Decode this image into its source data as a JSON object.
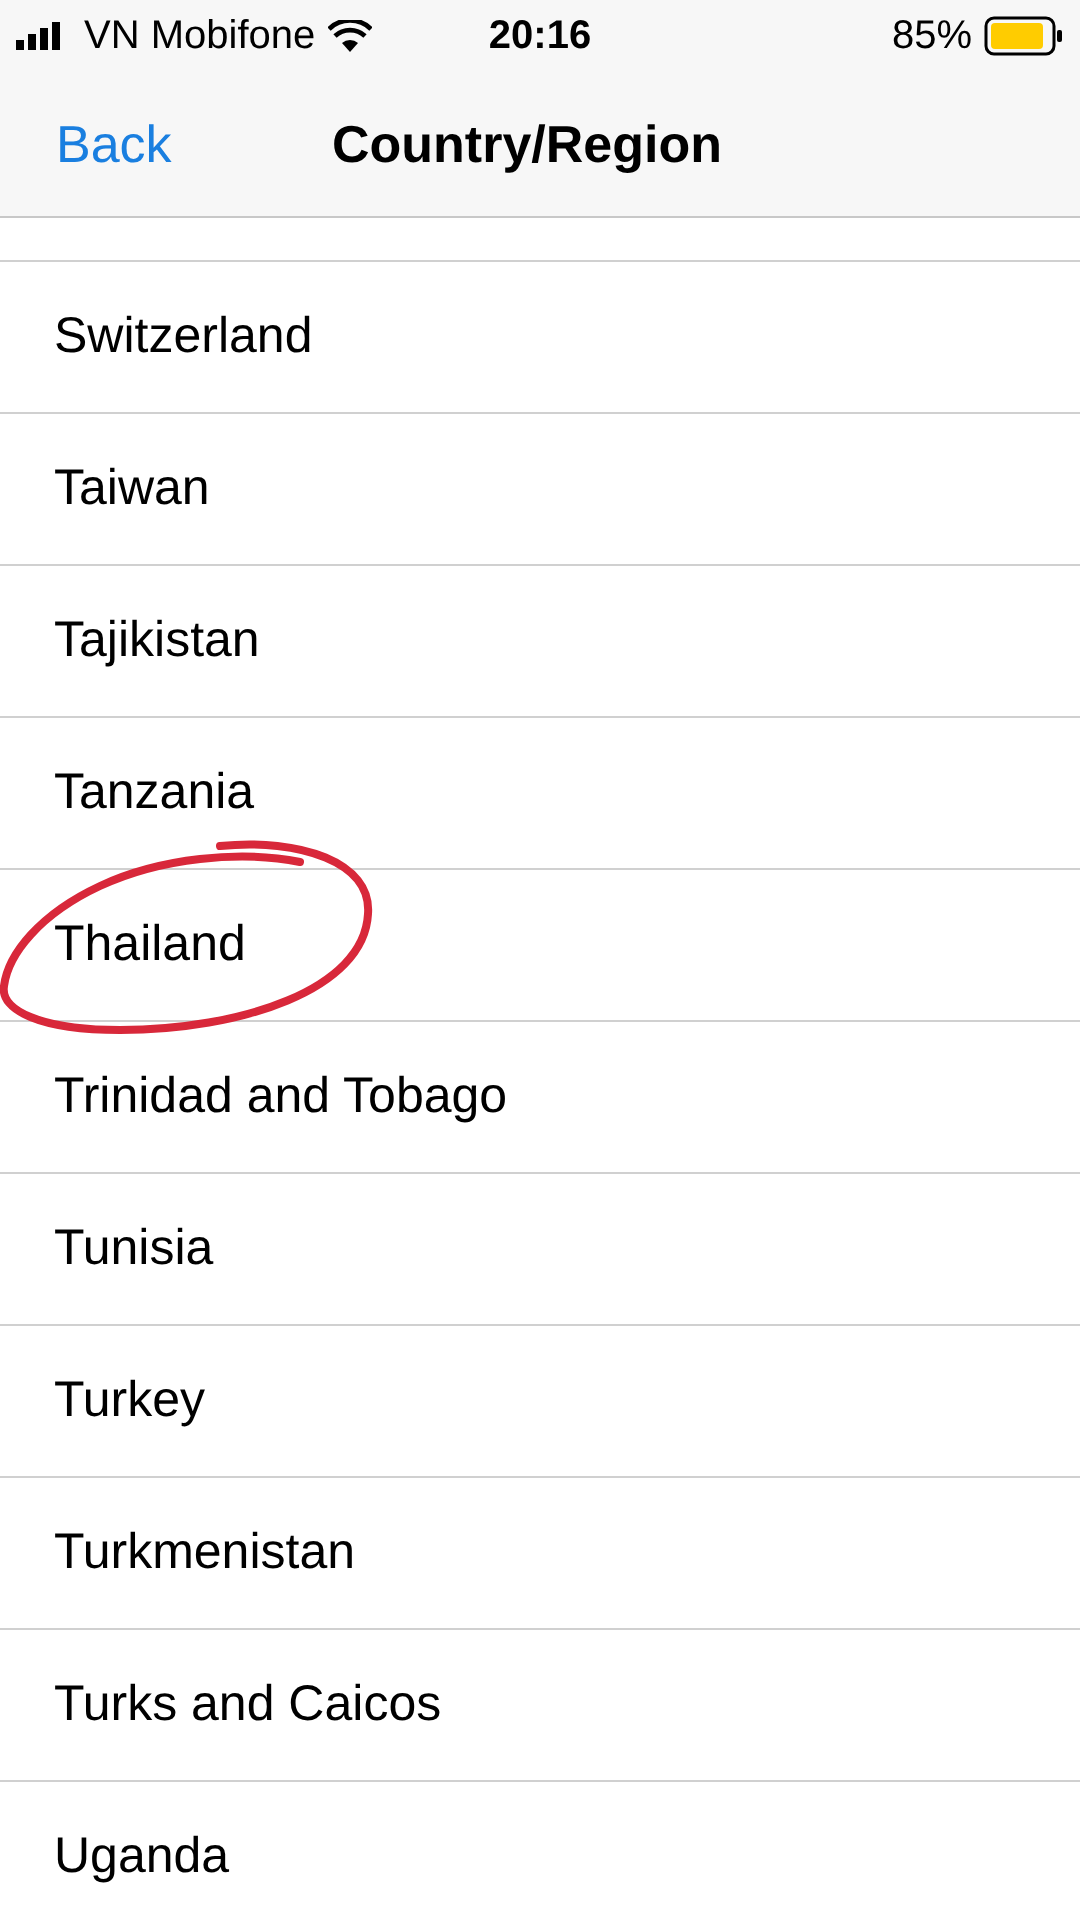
{
  "status_bar": {
    "carrier": "VN Mobifone",
    "time": "20:16",
    "battery": "85%"
  },
  "nav": {
    "back": "Back",
    "title": "Country/Region"
  },
  "rows": [
    {
      "label": "Switzerland",
      "circled": false
    },
    {
      "label": "Taiwan",
      "circled": false
    },
    {
      "label": "Tajikistan",
      "circled": false
    },
    {
      "label": "Tanzania",
      "circled": false
    },
    {
      "label": "Thailand",
      "circled": true
    },
    {
      "label": "Trinidad and Tobago",
      "circled": false
    },
    {
      "label": "Tunisia",
      "circled": false
    },
    {
      "label": "Turkey",
      "circled": false
    },
    {
      "label": "Turkmenistan",
      "circled": false
    },
    {
      "label": "Turks and Caicos",
      "circled": false
    },
    {
      "label": "Uganda",
      "circled": false
    }
  ]
}
